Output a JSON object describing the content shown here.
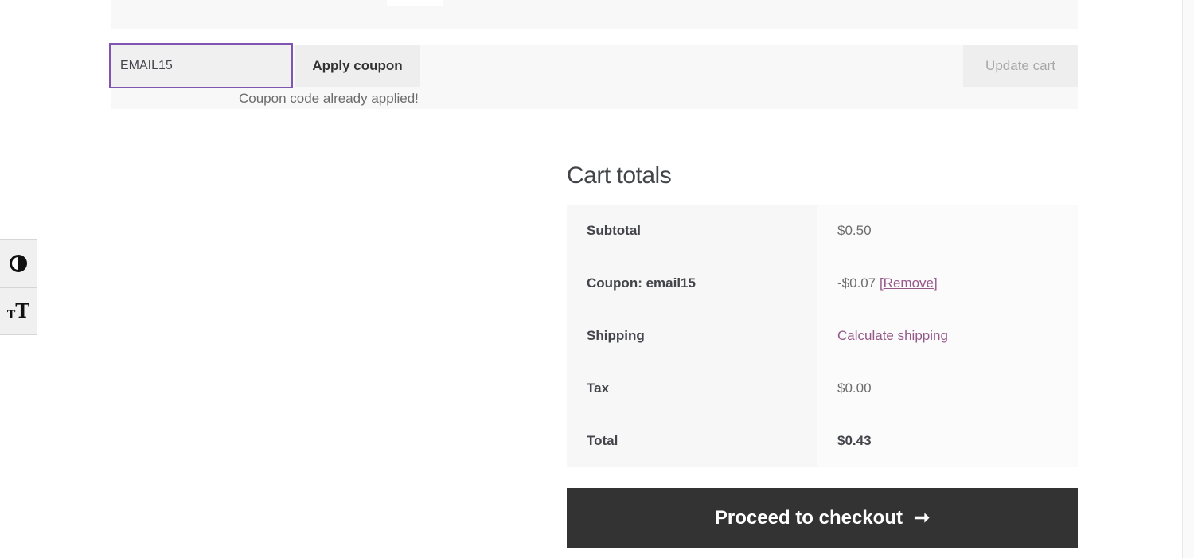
{
  "coupon": {
    "input_value": "EMAIL15",
    "apply_label": "Apply coupon",
    "message": "Coupon code already applied!"
  },
  "cart_actions": {
    "update_label": "Update cart"
  },
  "accessibility_toolbar": {
    "contrast_icon": "contrast-icon",
    "text_size_icon": "text-size-icon",
    "text_size_glyph_small": "T",
    "text_size_glyph_big": "T"
  },
  "cart_totals": {
    "heading": "Cart totals",
    "rows": [
      {
        "label": "Subtotal",
        "value": "$0.50"
      },
      {
        "label": "Coupon: email15",
        "value": "-$0.07",
        "remove_open": "[",
        "remove_label": "Remove",
        "remove_close": "]"
      },
      {
        "label": "Shipping",
        "link": "Calculate shipping"
      },
      {
        "label": "Tax",
        "value": "$0.00"
      },
      {
        "label": "Total",
        "value": "$0.43"
      }
    ],
    "checkout_label": "Proceed to checkout",
    "checkout_arrow": "➞"
  },
  "colors": {
    "accent": "#7f54b3",
    "link": "#96588a",
    "checkout_bg": "#333333"
  }
}
